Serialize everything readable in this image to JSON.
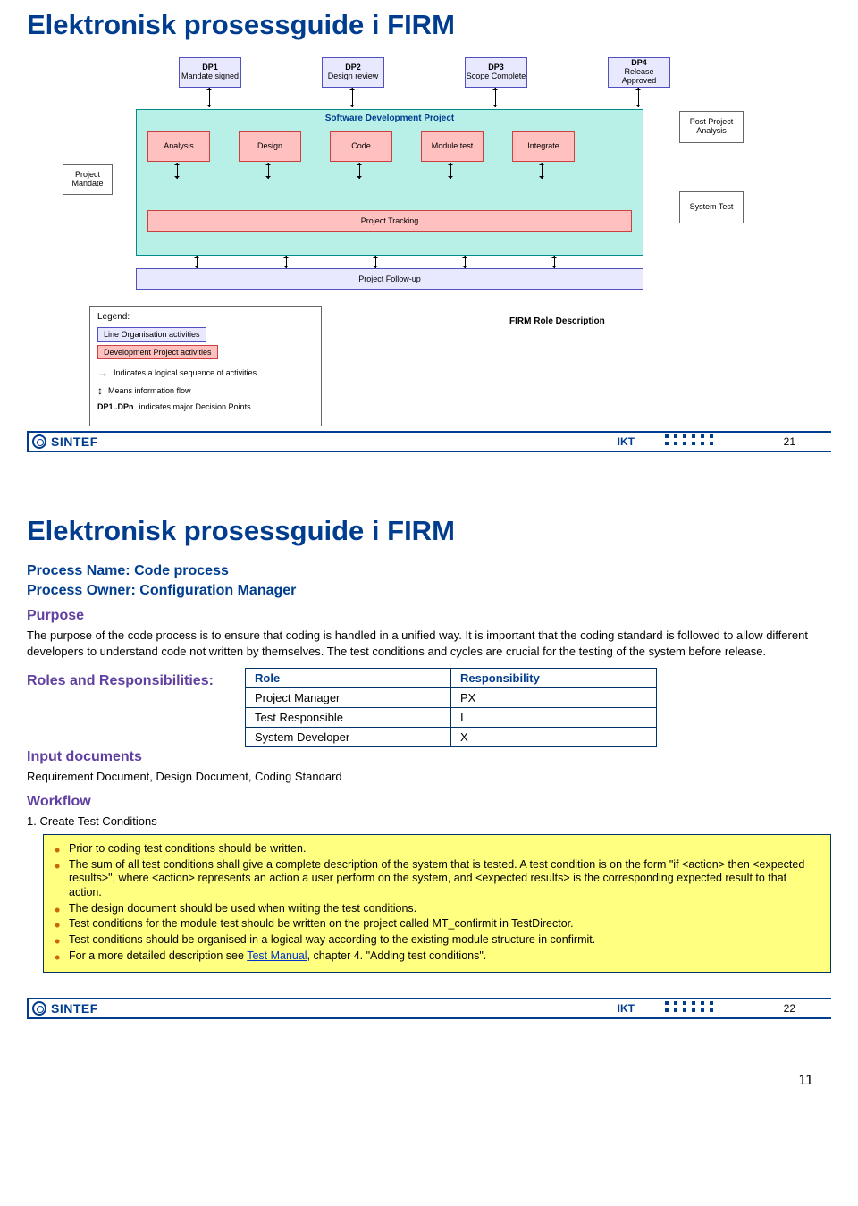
{
  "slide1": {
    "title": "Elektronisk prosessguide i FIRM",
    "dp": [
      {
        "h": "DP1",
        "t": "Mandate signed"
      },
      {
        "h": "DP2",
        "t": "Design review"
      },
      {
        "h": "DP3",
        "t": "Scope Complete"
      },
      {
        "h": "DP4",
        "t": "Release Approved"
      }
    ],
    "project_mandate": "Project Mandate",
    "main_title": "Software Development Project",
    "phases": [
      "Analysis",
      "Design",
      "Code",
      "Module test",
      "Integrate"
    ],
    "tracking": "Project Tracking",
    "followup": "Project Follow-up",
    "post_proj": "Post Project Analysis",
    "system_test": "System Test",
    "firm_role": "FIRM Role Description",
    "legend": {
      "title": "Legend:",
      "line_org": "Line Organisation activities",
      "dev_proj": "Development Project activities",
      "seq": "Indicates a logical sequence of activities",
      "flow": "Means information flow",
      "dp": "indicates major Decision Points",
      "dp_prefix": "DP1..DPn"
    },
    "footer": {
      "brand": "SINTEF",
      "ikt": "IKT",
      "page": "21"
    }
  },
  "slide2": {
    "title": "Elektronisk prosessguide i FIRM",
    "process_name_label": "Process Name: Code process",
    "process_owner_label": "Process Owner: Configuration Manager",
    "purpose_h": "Purpose",
    "purpose_body": "The purpose of the code process is to ensure that coding is handled in a unified way. It is important that the coding standard is followed to allow different developers to understand code not written by themselves. The test conditions and cycles are crucial for the testing of the system before release.",
    "roles_h": "Roles and Responsibilities:",
    "roles_table": {
      "h_role": "Role",
      "h_resp": "Responsibility",
      "rows": [
        {
          "role": "Project Manager",
          "resp": "PX"
        },
        {
          "role": "Test Responsible",
          "resp": "I"
        },
        {
          "role": "System Developer",
          "resp": "X"
        }
      ]
    },
    "input_h": "Input documents",
    "input_body": "Requirement Document, Design Document, Coding Standard",
    "workflow_h": "Workflow",
    "workflow_step1": "1. Create Test Conditions",
    "yellow": {
      "b1": "Prior to coding test conditions should be written.",
      "b2": "The sum of all test conditions shall give a complete description of the system that is tested. A test condition is on the form \"if <action> then <expected results>\", where <action> represents an action a user perform on the system, and <expected results> is the corresponding expected result to that action.",
      "b3": "The design document should be used when writing the test conditions.",
      "b4": "Test conditions for the module test should be written on the project called MT_confirmit in TestDirector.",
      "b5": "Test conditions should be organised in a logical way according to the existing module structure in confirmit.",
      "b6_pre": "For a more detailed description see ",
      "b6_link": "Test Manual",
      "b6_post": ", chapter 4. \"Adding test conditions\"."
    },
    "footer": {
      "brand": "SINTEF",
      "ikt": "IKT",
      "page": "22"
    }
  },
  "pdf_page": "11"
}
